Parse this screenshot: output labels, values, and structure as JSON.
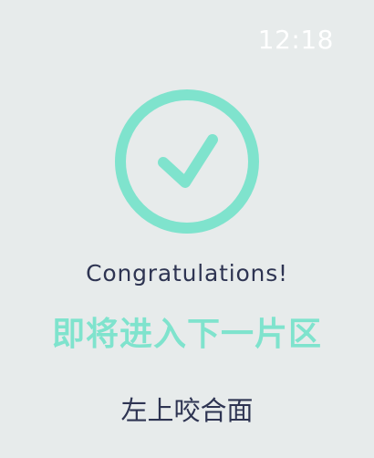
{
  "status_bar": {
    "time": "12:18"
  },
  "icons": {
    "success": "check-circle-icon"
  },
  "colors": {
    "background": "#e7ebeb",
    "accent": "#7fe3cd",
    "text_primary": "#2e3452",
    "time_text": "#ffffff"
  },
  "main": {
    "title": "Congratulations!",
    "subtitle": "即将进入下一片区",
    "action_text": "左上咬合面"
  }
}
